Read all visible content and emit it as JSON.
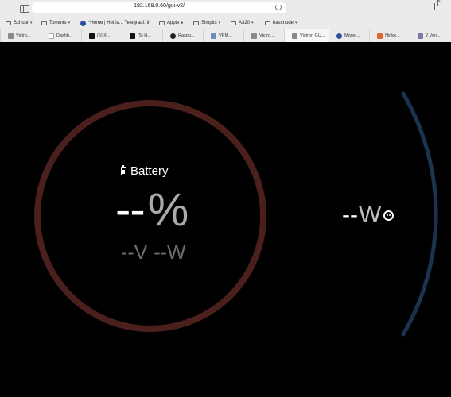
{
  "browser": {
    "url": "192.168.0.60/gui-v2/",
    "bookmarks": [
      {
        "label": "Schuur",
        "type": "folder"
      },
      {
        "label": "Torrents",
        "type": "folder"
      },
      {
        "label": "*Home | Het la... Telegraaf.nl",
        "type": "site"
      },
      {
        "label": "Apple",
        "type": "folder-dot"
      },
      {
        "label": "Simpits",
        "type": "folder"
      },
      {
        "label": "A320",
        "type": "folder"
      },
      {
        "label": "hassnode",
        "type": "folder"
      }
    ],
    "tabs": [
      {
        "label": "Victro...",
        "icon_color": "#8a8a8a",
        "active": false
      },
      {
        "label": "Dashb...",
        "icon_color": "#ffffff",
        "active": false
      },
      {
        "label": "(5) X...",
        "icon_color": "#111111",
        "active": false
      },
      {
        "label": "(5) H...",
        "icon_color": "#111111",
        "active": false
      },
      {
        "label": "Raspb...",
        "icon_color": "#222222",
        "active": false
      },
      {
        "label": "VRM...",
        "icon_color": "#6c8ebf",
        "active": false
      },
      {
        "label": "Victro...",
        "icon_color": "#8a8a8a",
        "active": false
      },
      {
        "label": "Victron GU...",
        "icon_color": "#8a8a8a",
        "active": true
      },
      {
        "label": "Mogel...",
        "icon_color": "#2a4f9e",
        "active": false
      },
      {
        "label": "Ninke...",
        "icon_color": "#e06a2c",
        "active": false
      },
      {
        "label": "2 Ven...",
        "icon_color": "#7a7aa0",
        "active": false
      }
    ]
  },
  "battery": {
    "title": "Battery",
    "soc_value": "--",
    "soc_unit": "%",
    "voltage_value": "--",
    "voltage_unit": "V",
    "power_value": "--",
    "power_unit": "W",
    "ring_color": "#4a1f1c"
  },
  "ac_loads": {
    "power_value": "--",
    "power_unit": "W",
    "icon": "socket-icon",
    "arc_color": "#1b3250"
  }
}
